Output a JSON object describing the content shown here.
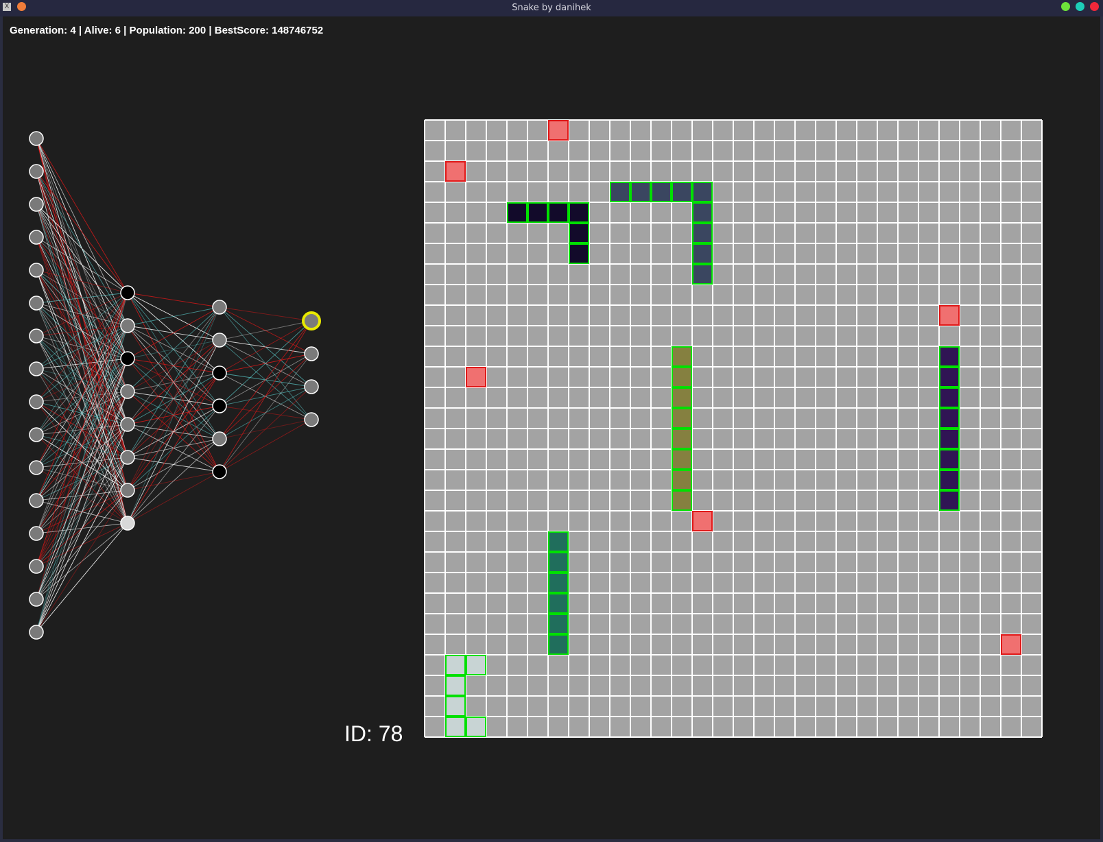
{
  "window": {
    "title": "Snake by danihek",
    "app_icon": "x-app-icon"
  },
  "stats": {
    "text": "Generation: 4 | Alive: 6 | Population: 200 | BestScore: 148746752",
    "generation": 4,
    "alive": 6,
    "population": 200,
    "best_score": 148746752
  },
  "snake_id": {
    "label": "ID: 78",
    "value": 78
  },
  "network": {
    "layers": [
      {
        "role": "input",
        "count": 16,
        "fills": [
          "#7a7a7a",
          "#7a7a7a",
          "#7a7a7a",
          "#7a7a7a",
          "#7a7a7a",
          "#7a7a7a",
          "#7a7a7a",
          "#7a7a7a",
          "#7a7a7a",
          "#7a7a7a",
          "#7a7a7a",
          "#7a7a7a",
          "#7a7a7a",
          "#7a7a7a",
          "#7a7a7a",
          "#7a7a7a"
        ]
      },
      {
        "role": "hidden1",
        "count": 8,
        "fills": [
          "#000000",
          "#7a7a7a",
          "#000000",
          "#7a7a7a",
          "#7a7a7a",
          "#7a7a7a",
          "#7a7a7a",
          "#d8d8d8"
        ]
      },
      {
        "role": "hidden2",
        "count": 6,
        "fills": [
          "#7a7a7a",
          "#7a7a7a",
          "#000000",
          "#000000",
          "#7a7a7a",
          "#000000"
        ]
      },
      {
        "role": "output",
        "count": 4,
        "fills": [
          "#7a7a7a",
          "#7a7a7a",
          "#7a7a7a",
          "#7a7a7a"
        ],
        "selected_index": 0
      }
    ],
    "colors": {
      "positive": "#ffffff",
      "negative": "#e01818",
      "neutral": "#5fd6d6",
      "node_stroke": "#ffffff",
      "selected_ring": "#e8e800"
    }
  },
  "board": {
    "cols": 30,
    "rows": 30,
    "background": "#a3a3a3",
    "grid_color": "#ffffff",
    "snake_border": "#00e000",
    "food_color": "#f07070",
    "food_border": "#e01818",
    "food": [
      [
        6,
        0
      ],
      [
        1,
        2
      ],
      [
        25,
        9
      ],
      [
        2,
        12
      ],
      [
        13,
        19
      ],
      [
        28,
        25
      ]
    ],
    "snakes": [
      {
        "color": "#120a2a",
        "cells": [
          [
            4,
            4
          ],
          [
            5,
            4
          ],
          [
            6,
            4
          ],
          [
            7,
            4
          ],
          [
            7,
            5
          ],
          [
            7,
            6
          ]
        ]
      },
      {
        "color": "#3a4660",
        "cells": [
          [
            9,
            3
          ],
          [
            10,
            3
          ],
          [
            11,
            3
          ],
          [
            12,
            3
          ],
          [
            13,
            3
          ],
          [
            13,
            4
          ],
          [
            13,
            5
          ],
          [
            13,
            6
          ],
          [
            13,
            7
          ]
        ]
      },
      {
        "color": "#858040",
        "cells": [
          [
            12,
            11
          ],
          [
            12,
            12
          ],
          [
            12,
            13
          ],
          [
            12,
            14
          ],
          [
            12,
            15
          ],
          [
            12,
            16
          ],
          [
            12,
            17
          ],
          [
            12,
            18
          ]
        ]
      },
      {
        "color": "#301454",
        "cells": [
          [
            25,
            11
          ],
          [
            25,
            12
          ],
          [
            25,
            13
          ],
          [
            25,
            14
          ],
          [
            25,
            15
          ],
          [
            25,
            16
          ],
          [
            25,
            17
          ],
          [
            25,
            18
          ]
        ]
      },
      {
        "color": "#206e5c",
        "cells": [
          [
            6,
            20
          ],
          [
            6,
            21
          ],
          [
            6,
            22
          ],
          [
            6,
            23
          ],
          [
            6,
            24
          ],
          [
            6,
            25
          ]
        ]
      },
      {
        "color": "#c8d4d4",
        "cells": [
          [
            1,
            26
          ],
          [
            2,
            26
          ],
          [
            1,
            27
          ],
          [
            1,
            28
          ],
          [
            1,
            29
          ],
          [
            2,
            29
          ]
        ]
      }
    ]
  }
}
